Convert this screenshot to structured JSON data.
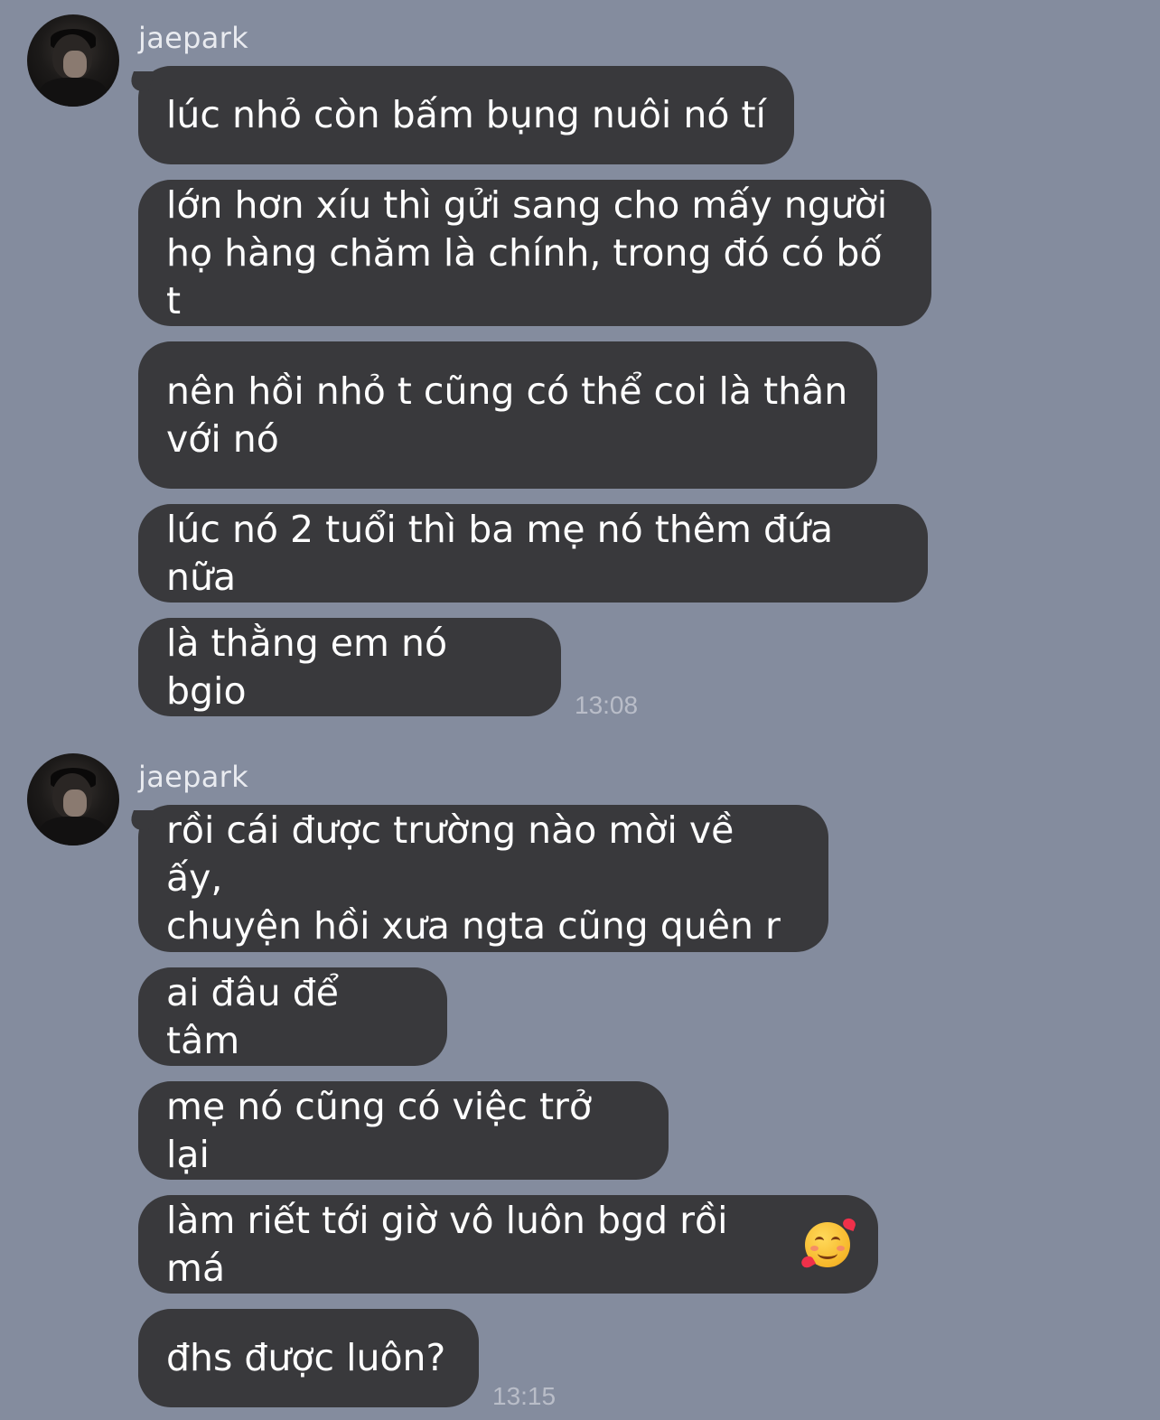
{
  "groups": [
    {
      "sender": "jaepark",
      "messages": [
        "lúc nhỏ còn bấm bụng nuôi nó tí",
        "lớn hơn xíu thì gửi sang cho mấy người\nhọ hàng chăm là chính, trong đó có bố t",
        "nên hồi nhỏ t cũng có thể coi là thân\nvới nó",
        "lúc nó 2 tuổi thì ba mẹ nó thêm đứa nữa",
        "là thằng em nó bgio"
      ],
      "time": "13:08"
    },
    {
      "sender": "jaepark",
      "messages": [
        "rồi cái được trường nào mời về ấy,\nchuyện hồi xưa ngta cũng quên r",
        "ai đâu để tâm",
        "mẹ nó cũng có việc trở lại",
        "làm riết tới giờ vô luôn bgd rồi má",
        "đhs được luôn?"
      ],
      "emoji": "smiling-face-with-hearts-icon",
      "time": "13:15"
    }
  ]
}
